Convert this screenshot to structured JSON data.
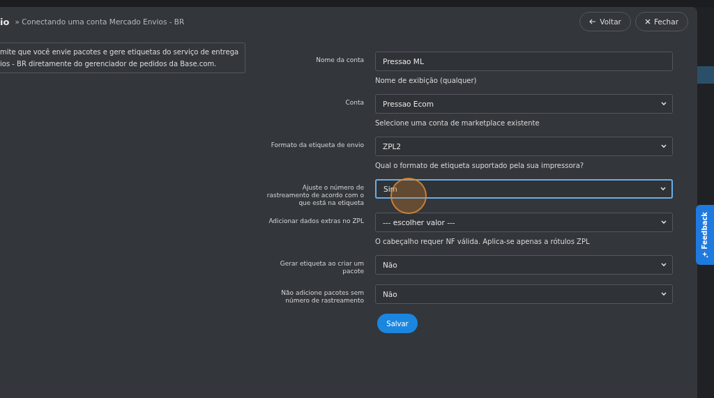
{
  "header": {
    "title": "io",
    "breadcrumb": "» Conectando uma conta Mercado Envios - BR",
    "buttons": [
      {
        "kind": "back",
        "label": "Voltar"
      },
      {
        "kind": "close",
        "label": "Fechar"
      }
    ]
  },
  "description": "mite que você envie pacotes e gere etiquetas do serviço de entrega\nios - BR diretamente do gerenciador de pedidos da Base.com.",
  "form": [
    {
      "label": "Nome da conta",
      "kind": "text",
      "value": "Pressao ML",
      "hint": "Nome de exibição (qualquer)",
      "focused": false
    },
    {
      "label": "Conta",
      "kind": "select",
      "value": "Pressao Ecom",
      "hint": "Selecione uma conta de marketplace existente",
      "focused": false
    },
    {
      "label": "Formato da etiqueta de envio",
      "kind": "select",
      "value": "ZPL2",
      "hint": "Qual o formato de etiqueta suportado pela sua impressora?",
      "focused": false
    },
    {
      "label": "Ajuste o número de\nrastreamento de acordo com o\nque está na etiqueta",
      "kind": "select",
      "value": "Sim",
      "focused": true
    },
    {
      "label": "Adicionar dados extras no ZPL",
      "kind": "select",
      "value": "--- escolher valor ---",
      "hint": "O cabeçalho requer NF válida. Aplica-se apenas a rótulos ZPL",
      "focused": false
    },
    {
      "label": "Gerar etiqueta ao criar um\npacote",
      "kind": "select",
      "value": "Não",
      "focused": false
    },
    {
      "label": "Não adicione pacotes sem\nnúmero de rastreamento",
      "kind": "select",
      "value": "Não",
      "focused": false
    }
  ],
  "submit": "Salvar",
  "feedback": "Feedback"
}
